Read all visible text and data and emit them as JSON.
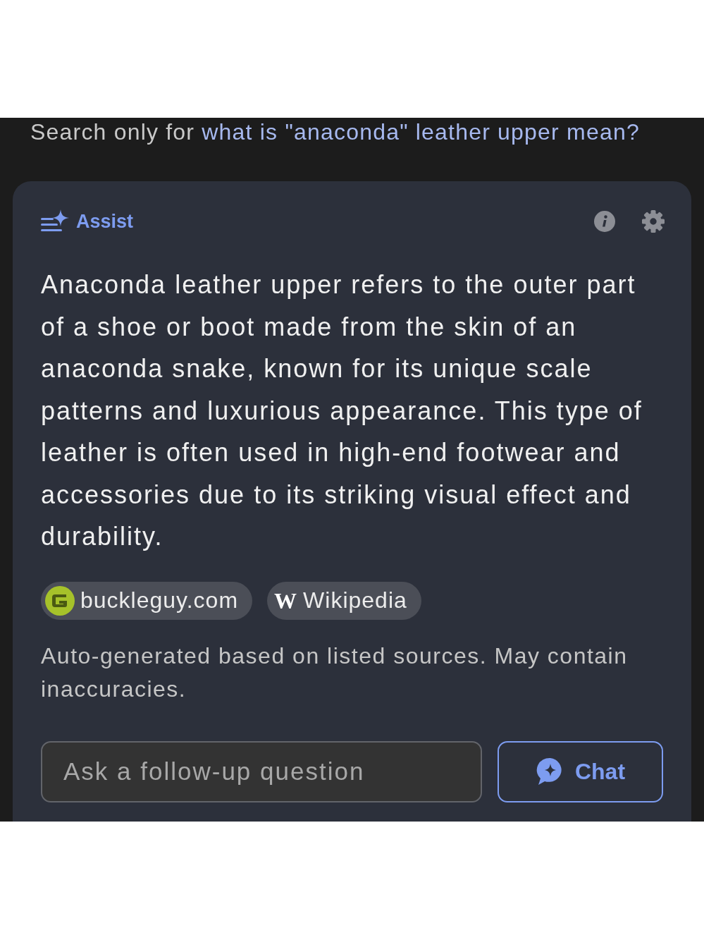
{
  "search_suggestion": {
    "prefix": "Search only for",
    "query": "what is \"anaconda\" leather upper mean?"
  },
  "assist": {
    "title": "Assist",
    "answer": "Anaconda leather upper refers to the outer part of a shoe or boot made from the skin of an anaconda snake, known for its unique scale patterns and luxurious appearance. This type of leather is often used in high-end footwear and accessories due to its striking visual effect and durability.",
    "sources": [
      {
        "kind": "site",
        "label": "buckleguy.com"
      },
      {
        "kind": "wikipedia",
        "icon": "W",
        "label": "Wikipedia"
      }
    ],
    "disclaimer": "Auto-generated based on listed sources. May contain inaccuracies.",
    "follow_up": {
      "placeholder": "Ask a follow-up question"
    },
    "chat_button": "Chat"
  }
}
